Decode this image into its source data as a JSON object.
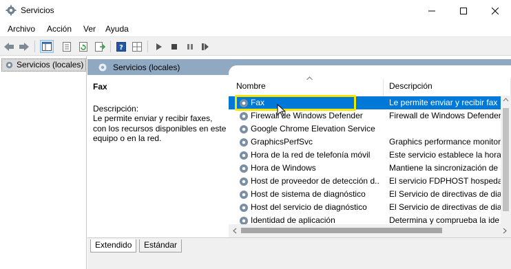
{
  "window": {
    "title": "Servicios"
  },
  "menu": [
    "Archivo",
    "Acción",
    "Ver",
    "Ayuda"
  ],
  "tree": {
    "root": "Servicios (locales)"
  },
  "panel": {
    "title": "Servicios (locales)",
    "selected_service": "Fax",
    "description_label": "Descripción:",
    "description_text": "Le permite enviar y recibir faxes, con los recursos disponibles en este equipo o en la red."
  },
  "list": {
    "columns": [
      "Nombre",
      "Descripción"
    ],
    "rows": [
      {
        "name": "Fax",
        "description": "Le permite enviar y recibir fax",
        "selected": true
      },
      {
        "name": "Firewall de Windows Defender",
        "description": "Firewall de Windows Defender"
      },
      {
        "name": "Google Chrome Elevation Service",
        "description": ""
      },
      {
        "name": "GraphicsPerfSvc",
        "description": "Graphics performance monitor"
      },
      {
        "name": "Hora de la red de telefonía móvil",
        "description": "Este servicio establece la hora"
      },
      {
        "name": "Hora de Windows",
        "description": "Mantiene la sincronización de"
      },
      {
        "name": "Host de proveedor de detección d...",
        "description": "El servicio FDPHOST hospeda"
      },
      {
        "name": "Host de sistema de diagnóstico",
        "description": "El Servicio de directivas de dia"
      },
      {
        "name": "Host del servicio de diagnóstico",
        "description": "El Servicio de directivas de dia"
      },
      {
        "name": "Identidad de aplicación",
        "description": "Determina y comprueba la ide"
      }
    ]
  },
  "tabs": [
    "Extendido",
    "Estándar"
  ],
  "colors": {
    "selection": "#0078d7",
    "header_band": "#8fa9c2",
    "highlight": "#f3e600"
  }
}
